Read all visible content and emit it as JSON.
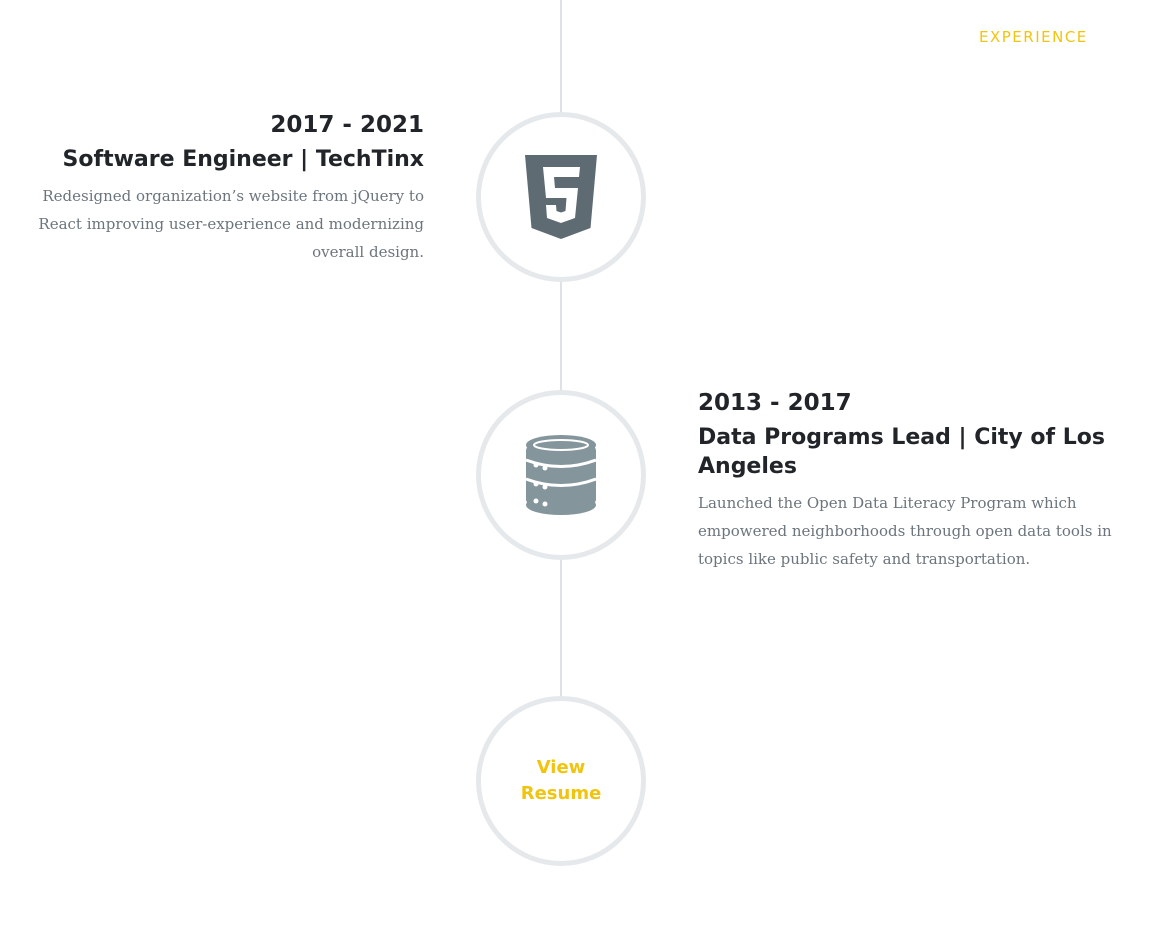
{
  "nav": {
    "experience_label": "EXPERIENCE"
  },
  "timeline": {
    "entries": [
      {
        "years": "2017 - 2021",
        "role": "Software Engineer | TechTinx",
        "description": "Redesigned organization’s website from jQuery to React improving user-experience and modernizing overall design.",
        "icon": "html5-icon"
      },
      {
        "years": "2013 - 2017",
        "role": "Data Programs Lead | City of Los Angeles",
        "description": "Launched the Open Data Literacy Program which empowered neighborhoods through open data tools in topics like public safety and transportation.",
        "icon": "database-icon"
      }
    ],
    "resume_button": {
      "line1": "View",
      "line2": "Resume"
    }
  },
  "colors": {
    "accent": "#f1c40f",
    "heading": "#212529",
    "body_text": "#6c757d",
    "icon_gray": "#6c757d",
    "circle_border": "#e6e9ec",
    "line": "#dee2e6"
  }
}
